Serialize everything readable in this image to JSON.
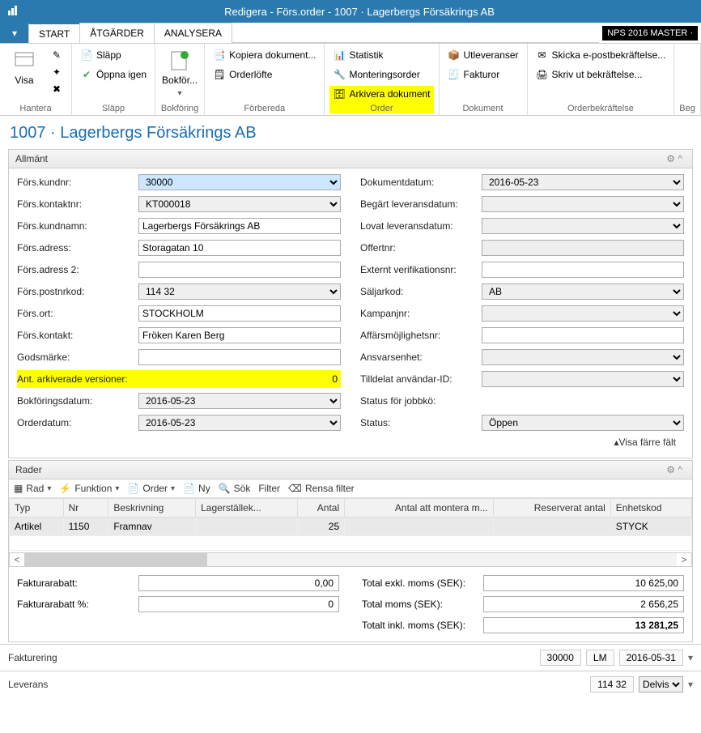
{
  "window": {
    "title": "Redigera - Förs.order - 1007 · Lagerbergs Försäkrings AB"
  },
  "menutabs": {
    "start": "START",
    "atgarder": "ÅTGÄRDER",
    "analysera": "ANALYSERA",
    "badge": "NPS 2016 MASTER ·"
  },
  "ribbon": {
    "hantera": {
      "visa": "Visa",
      "label": "Hantera"
    },
    "slapp": {
      "slapp": "Släpp",
      "oppna": "Öppna igen",
      "label": "Släpp"
    },
    "bokforing": {
      "bokfor": "Bokför...",
      "label": "Bokföring"
    },
    "forbereda": {
      "kopiera": "Kopiera dokument...",
      "orderlofte": "Orderlöfte",
      "label": "Förbereda"
    },
    "order": {
      "statistik": "Statistik",
      "monteringsorder": "Monteringsorder",
      "arkivera": "Arkivera dokument",
      "label": "Order"
    },
    "dokument": {
      "utlev": "Utleveranser",
      "fakturor": "Fakturor",
      "label": "Dokument"
    },
    "orderbek": {
      "skicka": "Skicka e-postbekräftelse...",
      "skriv": "Skriv ut bekräftelse...",
      "label": "Orderbekräftelse"
    },
    "beg": {
      "label": "Beg"
    }
  },
  "page_title": "1007 · Lagerbergs Försäkrings AB",
  "allmant": {
    "title": "Allmänt",
    "left": {
      "fors_kundnr": {
        "label": "Förs.kundnr:",
        "value": "30000"
      },
      "fors_kontaktnr": {
        "label": "Förs.kontaktnr:",
        "value": "KT000018"
      },
      "fors_kundnamn": {
        "label": "Förs.kundnamn:",
        "value": "Lagerbergs Försäkrings AB"
      },
      "fors_adress": {
        "label": "Förs.adress:",
        "value": "Storagatan 10"
      },
      "fors_adress2": {
        "label": "Förs.adress 2:",
        "value": ""
      },
      "fors_postnrkod": {
        "label": "Förs.postnrkod:",
        "value": "114 32"
      },
      "fors_ort": {
        "label": "Förs.ort:",
        "value": "STOCKHOLM"
      },
      "fors_kontakt": {
        "label": "Förs.kontakt:",
        "value": "Fröken Karen Berg"
      },
      "godsmarke": {
        "label": "Godsmärke:",
        "value": ""
      },
      "ant_arkiverade": {
        "label": "Ant. arkiverade versioner:",
        "value": "0"
      },
      "bokforingsdatum": {
        "label": "Bokföringsdatum:",
        "value": "2016-05-23"
      },
      "orderdatum": {
        "label": "Orderdatum:",
        "value": "2016-05-23"
      }
    },
    "right": {
      "dokumentdatum": {
        "label": "Dokumentdatum:",
        "value": "2016-05-23"
      },
      "begart": {
        "label": "Begärt leveransdatum:",
        "value": ""
      },
      "lovat": {
        "label": "Lovat leveransdatum:",
        "value": ""
      },
      "offertnr": {
        "label": "Offertnr:",
        "value": ""
      },
      "extver": {
        "label": "Externt verifikationsnr:",
        "value": ""
      },
      "saljarkod": {
        "label": "Säljarkod:",
        "value": "AB"
      },
      "kampanjnr": {
        "label": "Kampanjnr:",
        "value": ""
      },
      "affars": {
        "label": "Affärsmöjlighetsnr:",
        "value": ""
      },
      "ansvars": {
        "label": "Ansvarsenhet:",
        "value": ""
      },
      "tilldelat": {
        "label": "Tilldelat användar-ID:",
        "value": ""
      },
      "statusjobb": {
        "label": "Status för jobbkö:",
        "value": ""
      },
      "status": {
        "label": "Status:",
        "value": "Öppen"
      }
    },
    "show_less": "Visa färre fält"
  },
  "rader": {
    "title": "Rader",
    "toolbar": {
      "rad": "Rad",
      "funktion": "Funktion",
      "order": "Order",
      "ny": "Ny",
      "sok": "Sök",
      "filter": "Filter",
      "rensa": "Rensa filter"
    },
    "columns": {
      "typ": "Typ",
      "nr": "Nr",
      "beskrivning": "Beskrivning",
      "lager": "Lagerställek...",
      "antal": "Antal",
      "antalatt": "Antal att montera m...",
      "reserverat": "Reserverat antal",
      "enhetskod": "Enhetskod"
    },
    "rows": [
      {
        "typ": "Artikel",
        "nr": "1150",
        "beskrivning": "Framnav",
        "lager": "",
        "antal": "25",
        "antalatt": "",
        "reserverat": "",
        "enhetskod": "STYCK"
      }
    ]
  },
  "totals": {
    "fakturarabatt": {
      "label": "Fakturarabatt:",
      "value": "0,00"
    },
    "fakturarabatt_pct": {
      "label": "Fakturarabatt %:",
      "value": "0"
    },
    "total_exkl": {
      "label": "Total exkl. moms (SEK):",
      "value": "10 625,00"
    },
    "total_moms": {
      "label": "Total moms (SEK):",
      "value": "2 656,25"
    },
    "total_inkl": {
      "label": "Totalt inkl. moms (SEK):",
      "value": "13 281,25"
    }
  },
  "fakturering": {
    "title": "Fakturering",
    "kund": "30000",
    "kod": "LM",
    "datum": "2016-05-31"
  },
  "leverans": {
    "title": "Leverans",
    "postnr": "114 32",
    "typ": "Delvis"
  }
}
